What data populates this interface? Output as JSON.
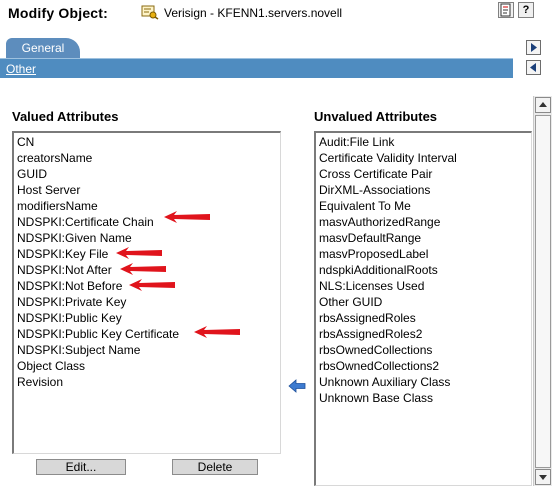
{
  "header": {
    "title": "Modify Object:",
    "object_name": "Verisign - KFENN1.servers.novell",
    "help_icon_label": "?"
  },
  "tabs": {
    "active": "General",
    "sub_link": "Other"
  },
  "valued": {
    "label": "Valued Attributes",
    "items": [
      "CN",
      "creatorsName",
      "GUID",
      "Host Server",
      "modifiersName",
      "NDSPKI:Certificate Chain",
      "NDSPKI:Given Name",
      "NDSPKI:Key File",
      "NDSPKI:Not After",
      "NDSPKI:Not Before",
      "NDSPKI:Private Key",
      "NDSPKI:Public Key",
      "NDSPKI:Public Key Certificate",
      "NDSPKI:Subject Name",
      "Object Class",
      "Revision"
    ],
    "highlighted": [
      "NDSPKI:Certificate Chain",
      "NDSPKI:Key File",
      "NDSPKI:Not After",
      "NDSPKI:Not Before",
      "NDSPKI:Public Key Certificate"
    ]
  },
  "unvalued": {
    "label": "Unvalued Attributes",
    "items": [
      "Audit:File Link",
      "Certificate Validity Interval",
      "Cross Certificate Pair",
      "DirXML-Associations",
      "Equivalent To Me",
      "masvAuthorizedRange",
      "masvDefaultRange",
      "masvProposedLabel",
      "ndspkiAdditionalRoots",
      "NLS:Licenses Used",
      "Other GUID",
      "rbsAssignedRoles",
      "rbsAssignedRoles2",
      "rbsOwnedCollections",
      "rbsOwnedCollections2",
      "Unknown Auxiliary Class",
      "Unknown Base Class"
    ]
  },
  "buttons": {
    "edit": "Edit...",
    "delete": "Delete"
  },
  "icons": {
    "object": "certificate-key-icon",
    "notes": "notes-icon",
    "help": "help-icon",
    "tab_next": "arrow-right-icon",
    "tab_prev": "arrow-left-icon",
    "move": "move-left-arrow-icon",
    "annotation": "red-arrow-icon"
  },
  "colors": {
    "tab_blue": "#5d8dbd",
    "strip_blue": "#4f8cc0",
    "annotation_red": "#e0141c",
    "move_arrow_blue": "#3d7bd0"
  }
}
